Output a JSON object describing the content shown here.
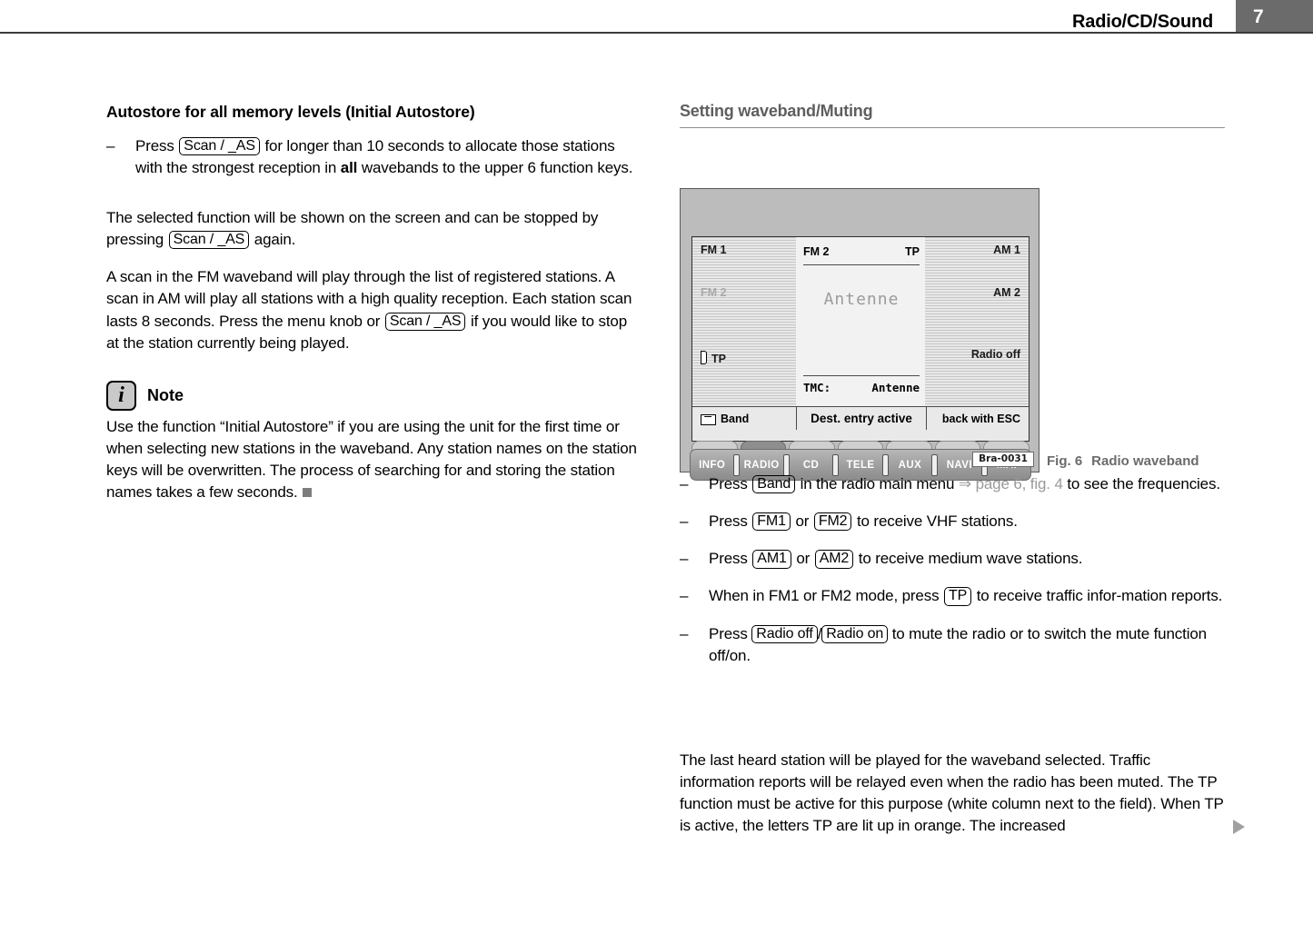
{
  "header": {
    "title": "Radio/CD/Sound",
    "page_number": "7"
  },
  "left_column": {
    "heading": "Autostore for all memory levels (Initial Autostore)",
    "bullet1": {
      "dash": "–",
      "pre": "Press",
      "key": "Scan / _AS",
      "post": "for longer than 10 seconds to allocate those stations with the strongest reception in",
      "emphasis": "all",
      "tail": "wavebands to the upper 6 function keys."
    },
    "para1": {
      "pre": "The selected function will be shown on the screen and can be stopped by pressing",
      "key": "Scan / _AS",
      "post": "again."
    },
    "para2": {
      "pre": "A scan in the FM waveband will play through the list of registered stations. A scan in AM will play all stations with a high quality reception. Each station scan lasts 8 seconds. Press the menu knob or",
      "key": "Scan / _AS",
      "post": "if you would like to stop at the station currently being played."
    },
    "note": {
      "icon_glyph": "i",
      "label": "Note",
      "body": "Use the function “Initial Autostore” if you are using the unit for the first time or when selecting new stations in the waveband. Any station names on the station keys will be overwritten. The process of searching for and storing the station names takes a few seconds."
    }
  },
  "right_column": {
    "heading": "Setting waveband/Muting",
    "figure": {
      "caption_number": "Fig. 6",
      "caption_text": "Radio waveband",
      "code_label": "Bra-0031",
      "screen": {
        "left_panel": [
          "FM 1",
          "FM 2",
          "TP"
        ],
        "left_panel_dim_index": 1,
        "right_panel": [
          "AM 1",
          "AM 2",
          "Radio off"
        ],
        "center_top_left": "FM 2",
        "center_top_right": "TP",
        "center_station": "Antenne",
        "tmc_label": "TMC:",
        "tmc_value": "Antenne",
        "softkey_left": "Band",
        "softkey_center": "Dest. entry active",
        "softkey_right": "back with ESC"
      },
      "hardware_buttons": [
        "INFO",
        "RADIO",
        "CD",
        "TELE",
        "AUX",
        "NAVI",
        "MAP"
      ],
      "active_button_index": 1
    },
    "bullets": [
      {
        "dash": "–",
        "pre": "Press",
        "key": "Band",
        "mid": "in the radio main menu",
        "xref_arrow": "⇒",
        "xref": "page 6, fig. 4",
        "post": "to see the frequencies."
      },
      {
        "dash": "–",
        "pre": "Press",
        "key": "FM1",
        "conj": "or",
        "key2": "FM2",
        "post": "to receive VHF stations."
      },
      {
        "dash": "–",
        "pre": "Press",
        "key": "AM1",
        "conj": "or",
        "key2": "AM2",
        "post": "to receive medium wave stations."
      },
      {
        "dash": "–",
        "pre": "When in FM1 or FM2 mode, press",
        "key": "TP",
        "post": "to receive traffic infor-mation reports."
      },
      {
        "dash": "–",
        "pre": "Press",
        "key": "Radio off",
        "slash": "/",
        "key2": "Radio on",
        "post": "to mute the radio or to switch the mute function off/on."
      }
    ],
    "closing_paragraph": "The last heard station will be played for the waveband selected. Traffic information reports will be relayed even when the radio has been muted. The TP function must be active for this purpose (white column next to the field). When TP is active, the letters TP are lit up in orange. The increased"
  },
  "colors": {
    "header_rule": "#3b3b3b",
    "page_block": "#6b6b6b",
    "section_heading": "#5e5e5e",
    "xref": "#9a9a9a",
    "figure_body": "#bcbcbc"
  }
}
